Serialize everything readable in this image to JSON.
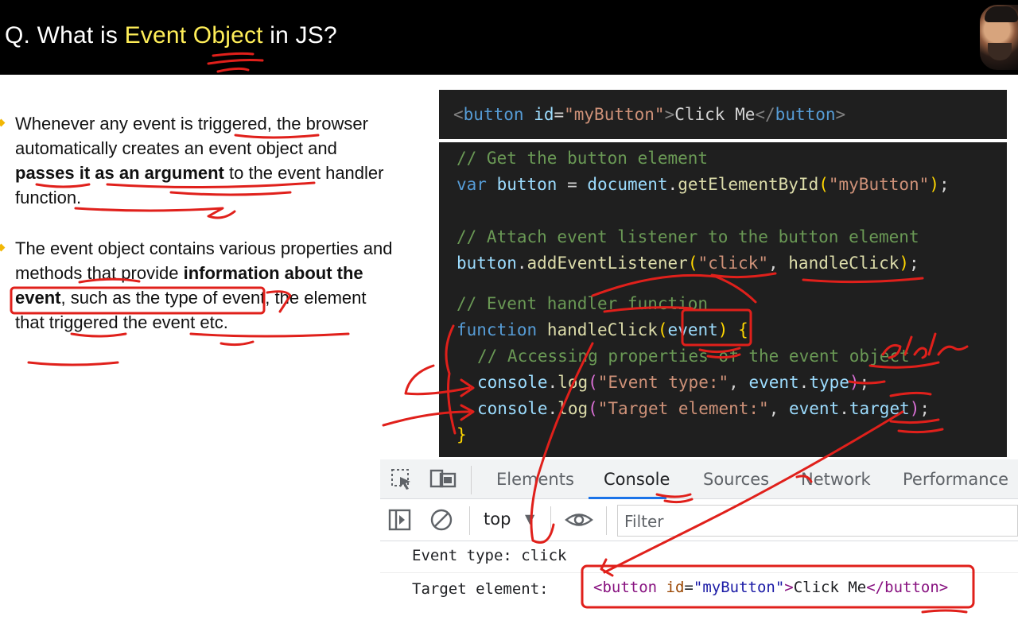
{
  "header": {
    "title_prefix": "Q. What is ",
    "title_highlight": "Event Object",
    "title_suffix": " in JS?"
  },
  "bullets": [
    {
      "parts": [
        "Whenever any event is triggered, the browser automatically creates an event object and ",
        "passes it as an argument",
        " to the event handler function."
      ]
    },
    {
      "parts": [
        "The event object contains various properties and methods that provide ",
        "information about the event",
        ", such as the type of event, the element that triggered the event etc."
      ]
    }
  ],
  "code_html": {
    "open_tag": "<",
    "tag_name": "button",
    "attr_name": "id",
    "eq": "=",
    "attr_value": "\"myButton\"",
    "close_bracket": ">",
    "text": "Click Me",
    "end_open": "</",
    "end_tag_name": "button",
    "end_close": ">"
  },
  "code_js": {
    "comment1": "// Get the button element",
    "var_kw": "var",
    "var_name": "button",
    "assign": " = ",
    "doc_obj": "document",
    "dot1": ".",
    "get_fn": "getElementById",
    "paren_open1": "(",
    "id_str": "\"myButton\"",
    "paren_close1": ")",
    "semi1": ";",
    "comment2": "// Attach event listener to the button element",
    "btn_obj": "button",
    "dot2": ".",
    "add_fn": "addEventListener",
    "paren_open2": "(",
    "click_str": "\"click\"",
    "comma2": ", ",
    "handler_name": "handleClick",
    "paren_close2": ")",
    "semi2": ";",
    "comment3": "// Event handler function",
    "function_kw": "function",
    "fn_name": "handleClick",
    "param_open": "(",
    "param": "event",
    "param_close": ")",
    "brace_open": " {",
    "comment4": "// Accessing properties of the event object",
    "console1": "console",
    "dot3": ".",
    "log1": "log",
    "lp1": "(",
    "str_type": "\"Event type:\"",
    "comma3": ", ",
    "event_obj1": "event",
    "dot4": ".",
    "prop_type": "type",
    "rp1": ")",
    "semi3": ";",
    "console2": "console",
    "dot5": ".",
    "log2": "log",
    "lp2": "(",
    "str_target": "\"Target element:\"",
    "comma4": ", ",
    "event_obj2": "event",
    "dot6": ".",
    "prop_target": "target",
    "rp2": ")",
    "semi4": ";",
    "brace_close": "}"
  },
  "devtools": {
    "tabs": [
      "Elements",
      "Console",
      "Sources",
      "Network",
      "Performance"
    ],
    "active_tab": "Console",
    "context": "top",
    "filter_placeholder": "Filter",
    "log_line1": "Event type: click",
    "log_line2_label": "Target element:",
    "el_open": "<",
    "el_tag": "button",
    "el_attr": " id",
    "el_eq": "=",
    "el_val": "\"myButton\"",
    "el_gt": ">",
    "el_text": "Click Me",
    "el_end_open": "</",
    "el_end_tag": "button",
    "el_end_gt": ">"
  },
  "annotations": {
    "handwritten_note": "click"
  },
  "colors": {
    "header_bg": "#000000",
    "title_highlight": "#ffee58",
    "code_bg": "#1f1f1f",
    "ink_red": "#e0201b",
    "bullet_marker": "#f2b705",
    "active_tab_underline": "#1a73e8"
  },
  "icons": [
    "inspect-icon",
    "device-toggle-icon",
    "sidebar-icon",
    "clear-console-icon",
    "dropdown-arrow-icon",
    "eye-icon"
  ]
}
